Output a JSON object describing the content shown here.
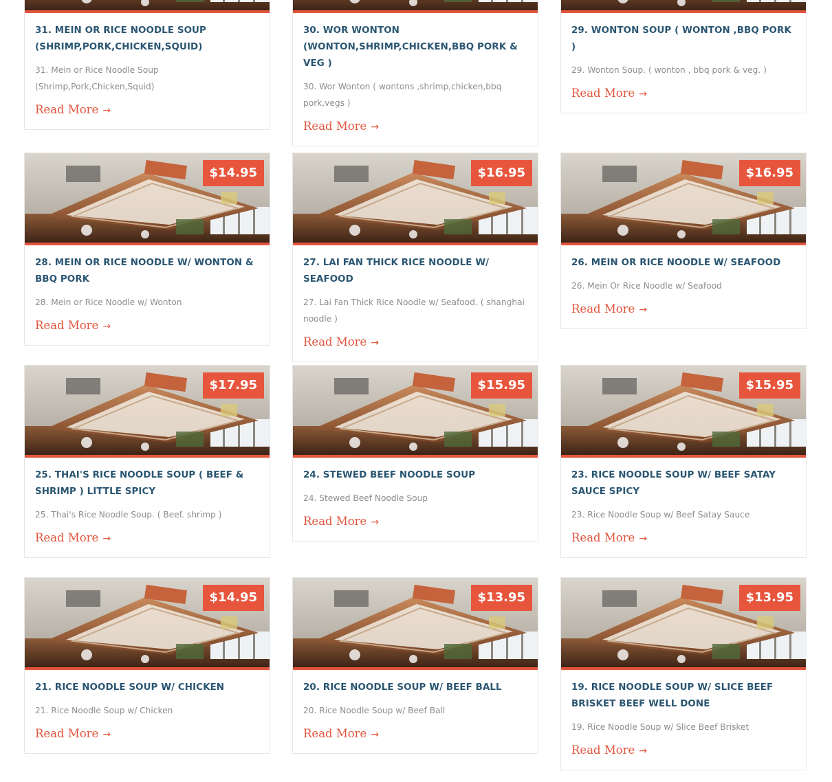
{
  "colors": {
    "accent": "#e8553d",
    "title": "#2a5672",
    "text": "#8d8d8d",
    "border": "#e7e7e7"
  },
  "read_more": "Read More",
  "arrow": "→",
  "image_icon": "restaurant-interior-photo",
  "items": [
    {
      "title": "31. Mein or Rice Noodle Soup (Shrimp,Pork,Chicken,Squid)",
      "desc": "31. Mein or Rice Noodle Soup (Shrimp,Pork,Chicken,Squid)"
    },
    {
      "title": "30. Wor Wonton (wonton,shrimp,chicken,bbq pork & veg )",
      "desc": "30. Wor Wonton ( wontons ,shrimp,chicken,bbq pork,vegs )"
    },
    {
      "title": "29. Wonton Soup ( wonton ,bbq pork )",
      "desc": "29. Wonton Soup. ( wonton , bbq pork & veg. )"
    },
    {
      "price": "$14.95",
      "title": "28. Mein or Rice Noodle w/ Wonton & BBQ Pork",
      "desc": "28. Mein or Rice Noodle w/ Wonton"
    },
    {
      "price": "$16.95",
      "title": "27. Lai Fan Thick Rice Noodle w/ Seafood",
      "desc": "27. Lai Fan Thick Rice Noodle w/ Seafood. ( shanghai noodle )"
    },
    {
      "price": "$16.95",
      "title": "26. Mein or Rice Noodle w/ Seafood",
      "desc": "26. Mein Or Rice Noodle w/ Seafood"
    },
    {
      "price": "$17.95",
      "title": "25. Thai's Rice Noodle Soup ( Beef & Shrimp ) Little Spicy",
      "desc": "25. Thai's Rice Noodle Soup. ( Beef. shrimp )"
    },
    {
      "price": "$15.95",
      "title": "24. Stewed Beef Noodle Soup",
      "desc": "24. Stewed Beef Noodle Soup"
    },
    {
      "price": "$15.95",
      "title": "23. Rice Noodle Soup w/ Beef Satay Sauce Spicy",
      "desc": "23. Rice Noodle Soup w/ Beef Satay Sauce"
    },
    {
      "price": "$14.95",
      "title": "21. Rice Noodle Soup w/ Chicken",
      "desc": "21. Rice Noodle Soup w/ Chicken"
    },
    {
      "price": "$13.95",
      "title": "20. Rice Noodle Soup w/ Beef Ball",
      "desc": "20. Rice Noodle Soup w/ Beef Ball"
    },
    {
      "price": "$13.95",
      "title": "19. Rice Noodle Soup w/ Slice Beef Brisket Beef Well Done",
      "desc": "19. Rice Noodle Soup w/ Slice Beef Brisket"
    }
  ]
}
